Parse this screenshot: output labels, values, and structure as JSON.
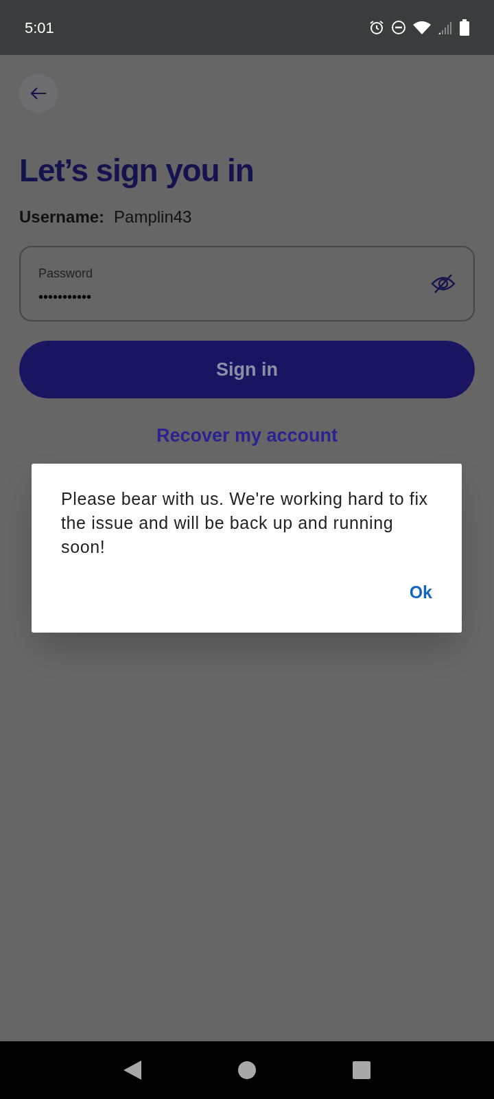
{
  "status_bar": {
    "time": "5:01"
  },
  "title": "Let’s sign you in",
  "username": {
    "label": "Username:",
    "value": "Pamplin43"
  },
  "password_field": {
    "label": "Password",
    "value": "•••••••••••"
  },
  "sign_in_button": "Sign in",
  "recover_link": "Recover my account",
  "dialog": {
    "message": "Please bear with us. We're working hard to fix the issue and will be back up and running soon!",
    "button": "Ok"
  }
}
